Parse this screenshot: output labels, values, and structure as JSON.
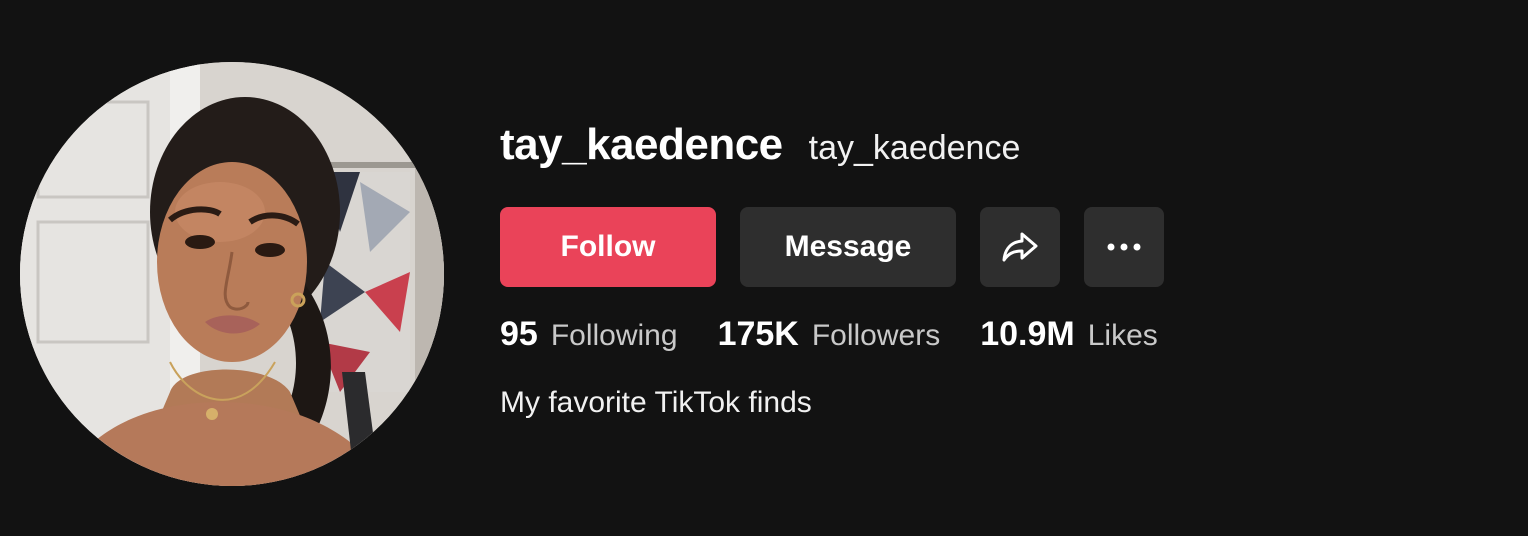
{
  "profile": {
    "unique_id": "tay_kaedence",
    "nickname": "tay_kaedence",
    "bio": "My favorite TikTok finds"
  },
  "actions": {
    "follow_label": "Follow",
    "message_label": "Message",
    "share_icon": "share-arrow-icon",
    "more_icon": "ellipsis-icon"
  },
  "stats": {
    "following": {
      "value": "95",
      "label": "Following"
    },
    "followers": {
      "value": "175K",
      "label": "Followers"
    },
    "likes": {
      "value": "10.9M",
      "label": "Likes"
    }
  },
  "colors": {
    "background": "#121212",
    "follow_button": "#ea4359",
    "secondary_button": "#2e2e2e"
  }
}
